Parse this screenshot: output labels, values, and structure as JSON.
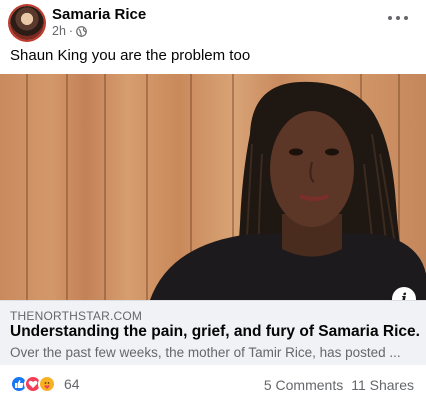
{
  "post": {
    "author": "Samaria Rice",
    "time": "2h",
    "separator": "·",
    "text": "Shaun King you are the problem too"
  },
  "link": {
    "domain": "THENORTHSTAR.COM",
    "title": "Understanding the pain, grief, and fury of Samaria Rice.",
    "description": "Over the past few weeks, the mother of Tamir Rice, has posted ..."
  },
  "engagement": {
    "reaction_count": "64",
    "comments": "5 Comments",
    "shares": "11 Shares"
  },
  "icons": {
    "privacy": "globe-icon",
    "menu": "more-options-icon",
    "info": "info-icon",
    "reactions": [
      "like-icon",
      "love-icon",
      "care-icon"
    ]
  },
  "colors": {
    "like": "#1877f2",
    "love": "#f33e58",
    "care": "#f7b125",
    "secondary_text": "#65676b",
    "link_background": "#f0f2f5"
  }
}
